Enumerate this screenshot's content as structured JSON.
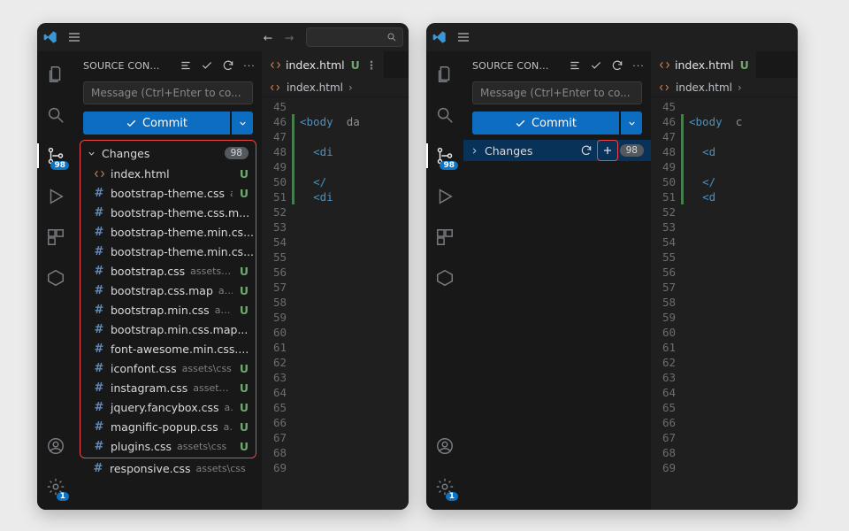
{
  "scm": {
    "title": "SOURCE CON...",
    "message_placeholder": "Message (Ctrl+Enter to co...",
    "commit_label": "Commit",
    "changes_label": "Changes",
    "changes_count": "98",
    "file_status": "U",
    "files": [
      {
        "icon": "html",
        "name": "index.html",
        "path": ""
      },
      {
        "icon": "hash",
        "name": "bootstrap-theme.css",
        "path": "ass..."
      },
      {
        "icon": "hash",
        "name": "bootstrap-theme.css.m...",
        "path": ""
      },
      {
        "icon": "hash",
        "name": "bootstrap-theme.min.cs...",
        "path": ""
      },
      {
        "icon": "hash",
        "name": "bootstrap-theme.min.cs...",
        "path": ""
      },
      {
        "icon": "hash",
        "name": "bootstrap.css",
        "path": "assets\\css"
      },
      {
        "icon": "hash",
        "name": "bootstrap.css.map",
        "path": "asset..."
      },
      {
        "icon": "hash",
        "name": "bootstrap.min.css",
        "path": "assets..."
      },
      {
        "icon": "hash",
        "name": "bootstrap.min.css.map...",
        "path": ""
      },
      {
        "icon": "hash",
        "name": "font-awesome.min.css....",
        "path": ""
      },
      {
        "icon": "hash",
        "name": "iconfont.css",
        "path": "assets\\css"
      },
      {
        "icon": "hash",
        "name": "instagram.css",
        "path": "assets\\css"
      },
      {
        "icon": "hash",
        "name": "jquery.fancybox.css",
        "path": "ass..."
      },
      {
        "icon": "hash",
        "name": "magnific-popup.css",
        "path": "ass..."
      },
      {
        "icon": "hash",
        "name": "plugins.css",
        "path": "assets\\css"
      }
    ],
    "overflow_file": {
      "icon": "hash",
      "name": "responsive.css",
      "path": "assets\\css"
    }
  },
  "activity": {
    "scm_badge": "98",
    "settings_badge": "1"
  },
  "editor": {
    "tab_name": "index.html",
    "tab_status": "U",
    "crumb": "index.html",
    "line_start": 45,
    "line_end": 69,
    "lines": {
      "45": "",
      "46": "body",
      "47": "",
      "48": "div",
      "49": "",
      "50": "div_close",
      "51": "div",
      "52": "",
      "53": "",
      "54": "",
      "55": "",
      "56": "",
      "57": "",
      "58": "",
      "59": "",
      "60": "",
      "61": "",
      "62": "",
      "63": "",
      "64": "",
      "65": "",
      "66": "",
      "67": "",
      "68": "",
      "69": ""
    },
    "tokens": {
      "body_open": "<body",
      "body_attr": "  da",
      "body_attr_short": "  c",
      "div_open": "<di",
      "div_open_short": "<d",
      "div_close": "</",
      "div_close2": "<di",
      "lt": "<"
    }
  }
}
